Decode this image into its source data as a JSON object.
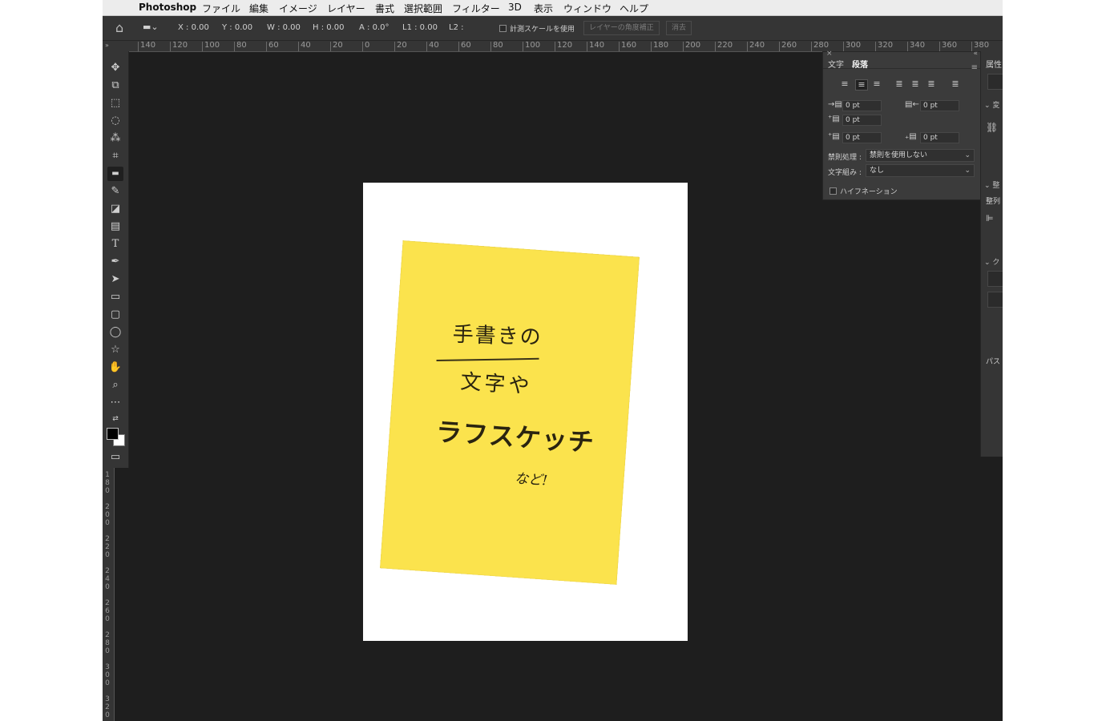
{
  "menubar": {
    "apple": "",
    "app_name": "Photoshop",
    "items": [
      "ファイル",
      "編集",
      "イメージ",
      "レイヤー",
      "書式",
      "選択範囲",
      "フィルター",
      "3D",
      "表示",
      "ウィンドウ",
      "ヘルプ"
    ]
  },
  "options_bar": {
    "home_icon": "home-icon",
    "x": "X : 0.00",
    "y": "Y : 0.00",
    "w": "W : 0.00",
    "h": "H : 0.00",
    "a": "A : 0.0°",
    "l1": "L1 : 0.00",
    "l2": "L2 :",
    "measure_scale": "計測スケールを使用",
    "straighten_button": "レイヤーの角度補正",
    "clear_button": "消去"
  },
  "ruler_top": [
    "140",
    "120",
    "100",
    "80",
    "60",
    "40",
    "20",
    "0",
    "20",
    "40",
    "60",
    "80",
    "100",
    "120",
    "140",
    "160",
    "180",
    "200",
    "220",
    "240",
    "260",
    "280",
    "300",
    "320",
    "340",
    "360",
    "380"
  ],
  "ruler_left": [
    "1\n8\n0",
    "2\n0\n0",
    "2\n2\n0",
    "2\n4\n0",
    "2\n6\n0",
    "2\n8\n0",
    "3\n0\n0",
    "3\n2\n0"
  ],
  "canvas": {
    "note_line1": "手書きの",
    "note_line2": "文字や",
    "note_line3": "ラフスケッチ",
    "note_line4": "など!"
  },
  "paragraph_panel": {
    "tab_character": "文字",
    "tab_paragraph": "段落",
    "left_indent": "0 pt",
    "right_indent": "0 pt",
    "first_line_indent": "0 pt",
    "space_before": "0 pt",
    "space_after": "0 pt",
    "kinsoku_label": "禁則処理 :",
    "kinsoku_value": "禁則を使用しない",
    "mojikumi_label": "文字組み :",
    "mojikumi_value": "なし",
    "hyphenation": "ハイフネーション"
  },
  "properties_panel": {
    "title": "属性",
    "section_transform": "変",
    "section_align": "整",
    "align_label": "整列",
    "section_quick": "ク",
    "paths_label": "パス"
  }
}
